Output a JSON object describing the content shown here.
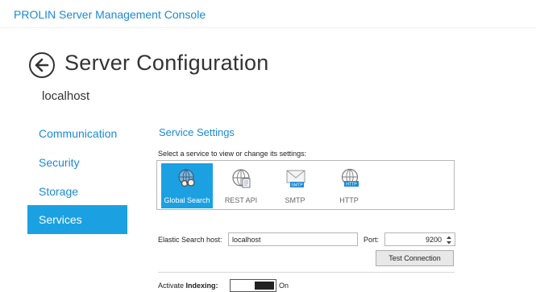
{
  "app": {
    "title": "PROLIN Server Management Console"
  },
  "page": {
    "title": "Server Configuration",
    "host": "localhost"
  },
  "nav": {
    "items": [
      {
        "label": "Communication"
      },
      {
        "label": "Security"
      },
      {
        "label": "Storage"
      },
      {
        "label": "Services",
        "active": true
      }
    ]
  },
  "services": {
    "title": "Service Settings",
    "hint": "Select a service to view or change its settings:",
    "items": [
      {
        "label": "Global Search",
        "icon": "globe-search-icon",
        "selected": true
      },
      {
        "label": "REST API",
        "icon": "globe-document-icon"
      },
      {
        "label": "SMTP",
        "icon": "envelope-smtp-icon",
        "badge": "SMTP"
      },
      {
        "label": "HTTP",
        "icon": "globe-http-icon",
        "badge": "HTTP"
      }
    ]
  },
  "elastic": {
    "host_label": "Elastic Search host:",
    "host_value": "localhost",
    "port_label": "Port:",
    "port_value": "9200",
    "test_button": "Test Connection"
  },
  "indexing": {
    "label_prefix": "Activate ",
    "label_bold": "Indexing:",
    "state": "On"
  },
  "colors": {
    "accent": "#1ba1e2",
    "link": "#1b8ad6"
  }
}
